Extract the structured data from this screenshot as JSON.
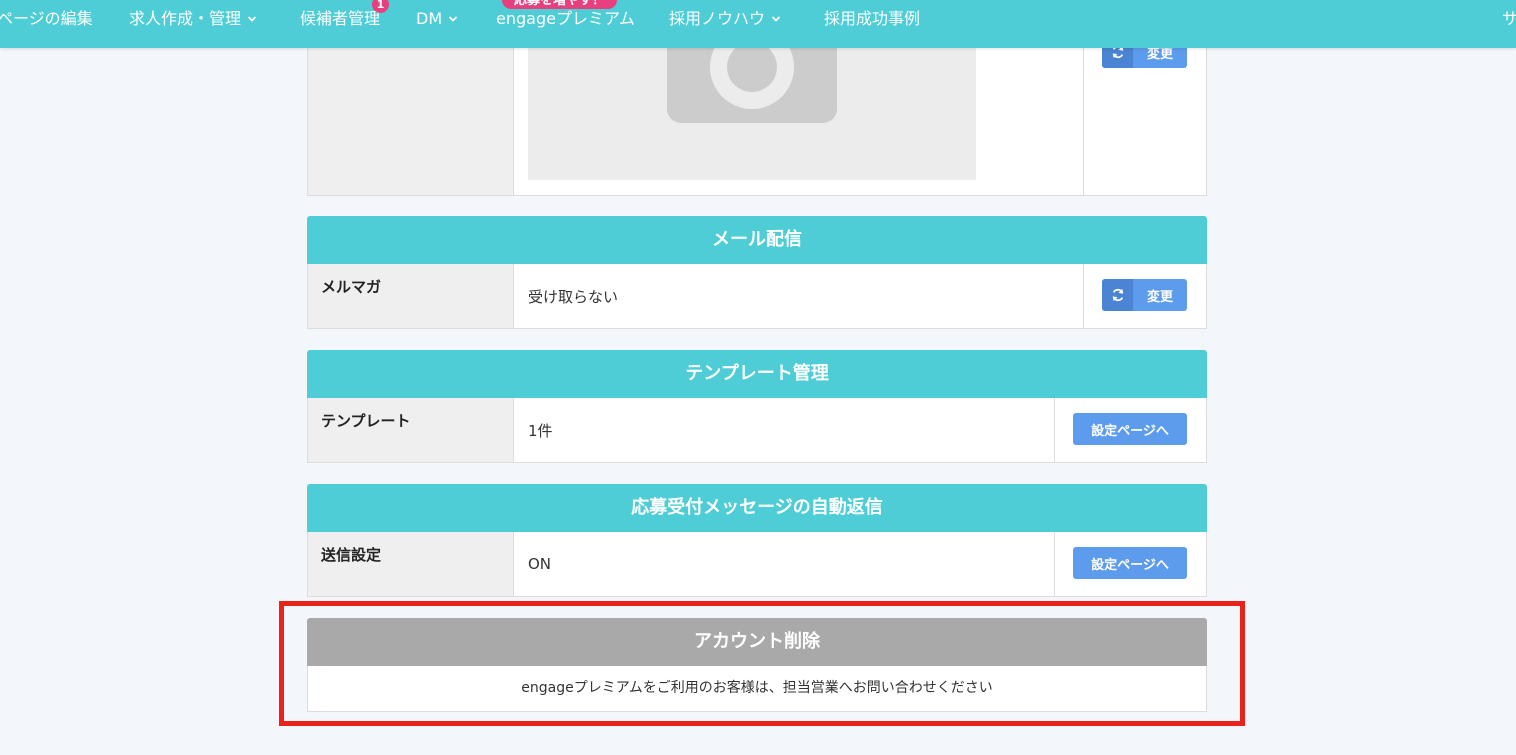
{
  "nav": {
    "items": [
      {
        "label": "ページの編集"
      },
      {
        "label": "求人作成・管理",
        "dropdown": true
      },
      {
        "label": "候補者管理",
        "badge": "1"
      },
      {
        "label": "DM",
        "dropdown": true
      },
      {
        "label": "engageプレミアム",
        "promo": "応募を増やす！"
      },
      {
        "label": "採用ノウハウ",
        "dropdown": true
      },
      {
        "label": "採用成功事例"
      },
      {
        "label": "サ"
      }
    ]
  },
  "photo_section": {
    "image_icon": "camera-placeholder-icon",
    "change_label": "変更"
  },
  "mail_section": {
    "title": "メール配信",
    "row_label": "メルマガ",
    "row_value": "受け取らない",
    "button_label": "変更",
    "button_icon": "refresh-icon"
  },
  "template_section": {
    "title": "テンプレート管理",
    "row_label": "テンプレート",
    "row_value": "1件",
    "button_label": "設定ページへ"
  },
  "autoreply_section": {
    "title": "応募受付メッセージの自動返信",
    "row_label": "送信設定",
    "row_value": "ON",
    "button_label": "設定ページへ"
  },
  "account_delete": {
    "title": "アカウント削除",
    "message": "engageプレミアムをご利用のお客様は、担当営業へお問い合わせください"
  },
  "colors": {
    "nav_bg": "#4ecdd6",
    "header_bg": "#4ecdd6",
    "delete_header_bg": "#a9a9a9",
    "button_bg": "#5d9cec",
    "badge": "#e8407e",
    "highlight": "#e8231b"
  }
}
